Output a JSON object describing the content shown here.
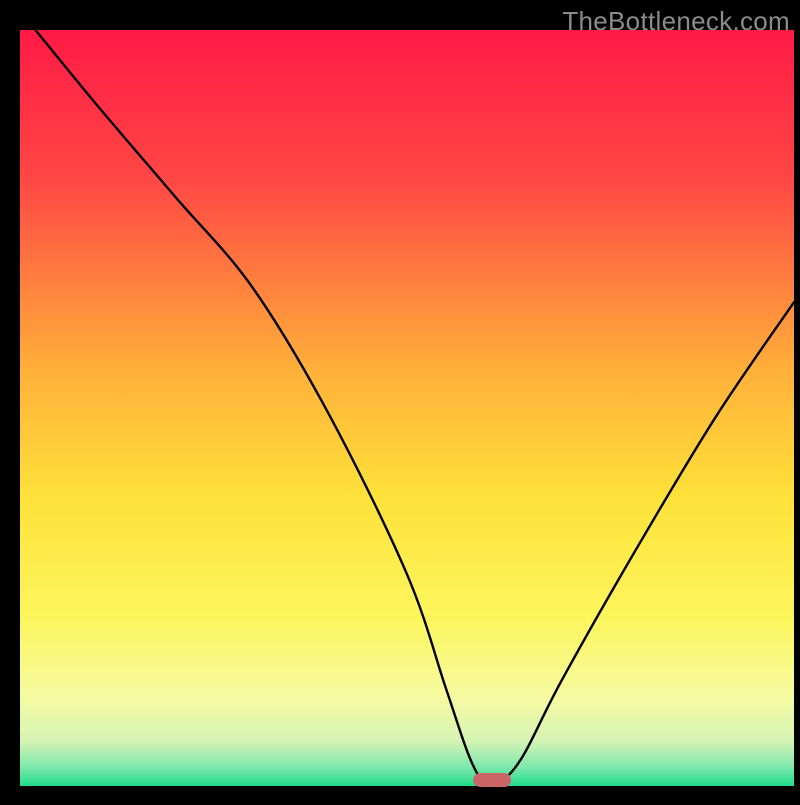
{
  "watermark": "TheBottleneck.com",
  "chart_data": {
    "type": "line",
    "title": "",
    "xlabel": "",
    "ylabel": "",
    "xlim": [
      0,
      100
    ],
    "ylim": [
      0,
      100
    ],
    "x": [
      2,
      10,
      20,
      30,
      40,
      50,
      55,
      58,
      60,
      62,
      65,
      70,
      80,
      90,
      100
    ],
    "values": [
      100,
      90,
      78,
      66,
      49,
      28,
      13,
      4,
      0.5,
      0.5,
      4,
      14,
      32,
      49,
      64
    ],
    "annotations": {
      "trough_marker": {
        "x": 61,
        "y": 0.8,
        "color": "#cc6666"
      }
    },
    "background_gradient": {
      "type": "vertical",
      "stops": [
        {
          "pos": 0.0,
          "color": "#ff1a46"
        },
        {
          "pos": 0.2,
          "color": "#ff4844"
        },
        {
          "pos": 0.45,
          "color": "#ffb03a"
        },
        {
          "pos": 0.62,
          "color": "#ffe23a"
        },
        {
          "pos": 0.78,
          "color": "#fcf65e"
        },
        {
          "pos": 0.88,
          "color": "#f6fba0"
        },
        {
          "pos": 0.94,
          "color": "#d6f4b4"
        },
        {
          "pos": 0.975,
          "color": "#7de8ac"
        },
        {
          "pos": 1.0,
          "color": "#1fdd8a"
        }
      ]
    },
    "frame_color": "#000000",
    "line_color": "#000000",
    "line_width": 2.4
  }
}
